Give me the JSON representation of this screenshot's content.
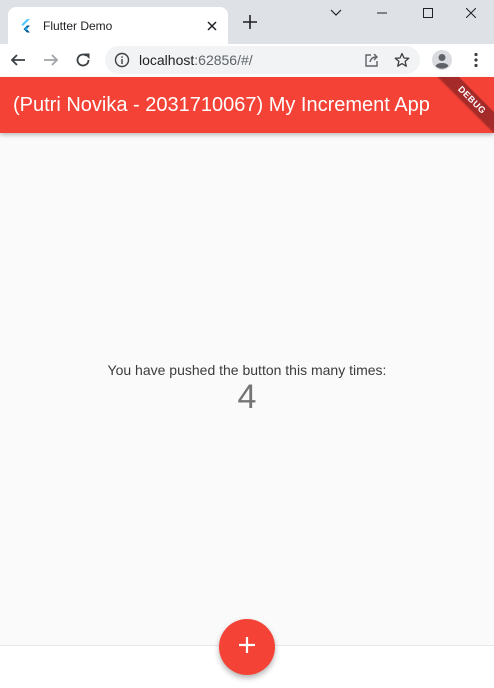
{
  "browser": {
    "tab": {
      "title": "Flutter Demo",
      "favicon": "flutter-icon"
    },
    "url": {
      "host": "localhost",
      "rest": ":62856/#/"
    },
    "icons": [
      "back-icon",
      "forward-icon",
      "reload-icon",
      "info-icon",
      "share-icon",
      "star-icon",
      "profile-icon",
      "menu-icon"
    ]
  },
  "app": {
    "title": "(Putri Novika - 2031710067) My Increment App",
    "debug_label": "DEBUG",
    "counter_label": "You have pushed the button this many times:",
    "counter_value": "4",
    "fab_icon": "add-icon"
  },
  "colors": {
    "primary": "#f44336",
    "debug_banner": "#a52a2a",
    "background": "#fafafa"
  }
}
